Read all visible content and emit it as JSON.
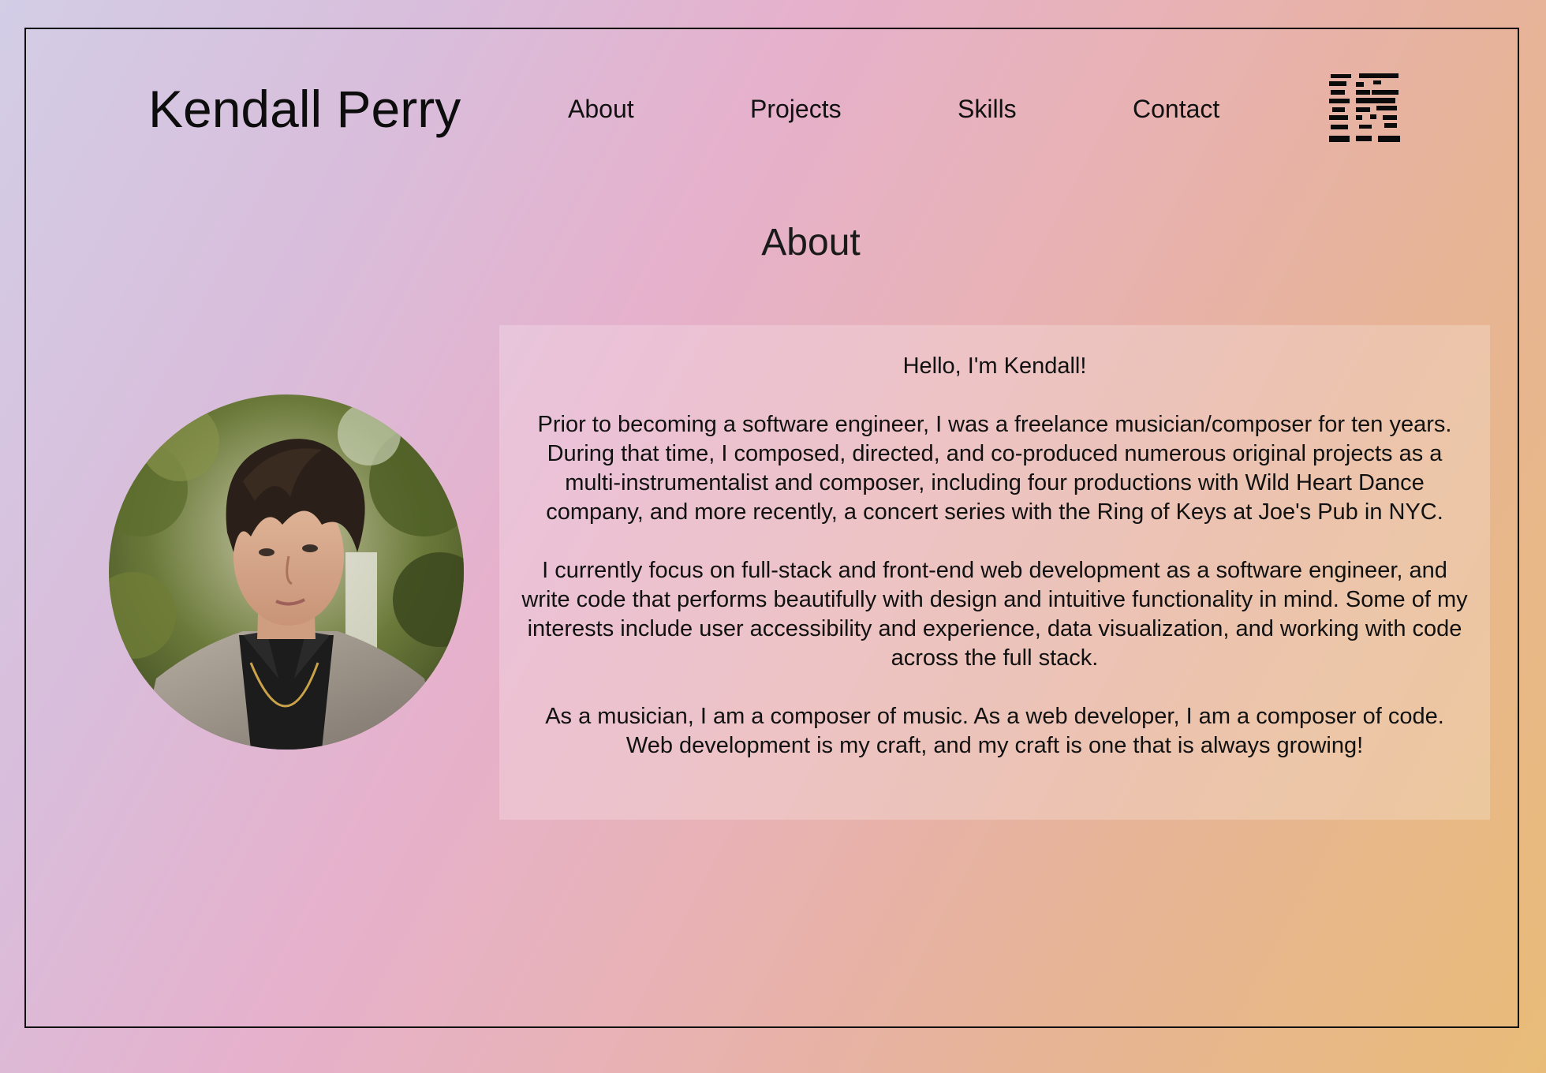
{
  "header": {
    "site_title": "Kendall Perry",
    "nav": [
      {
        "label": "About"
      },
      {
        "label": "Projects"
      },
      {
        "label": "Skills"
      },
      {
        "label": "Contact"
      }
    ],
    "logo_icon": "kp-monogram-logo-icon"
  },
  "about": {
    "heading": "About",
    "greeting": "Hello, I'm Kendall!",
    "paragraphs": [
      "Prior to becoming a software engineer, I was a freelance musician/composer for ten years. During that time, I composed, directed, and co-produced numerous original projects as a multi-instrumentalist and composer, including four productions with Wild Heart Dance company, and more recently, a concert series with the Ring of Keys at Joe's Pub in NYC.",
      "I currently focus on full-stack and front-end web development as a software engineer, and write code that performs beautifully with design and intuitive functionality in mind. Some of my interests include user accessibility and experience, data visualization, and working with code across the full stack.",
      "As a musician, I am a composer of music. As a web developer, I am a composer of code. Web development is my craft, and my craft is one that is always growing!"
    ]
  },
  "colors": {
    "background_start": "#d3cde6",
    "background_mid": "#e6b1cc",
    "background_end": "#e8bc78",
    "frame_border": "#111111",
    "text": "#111111"
  }
}
